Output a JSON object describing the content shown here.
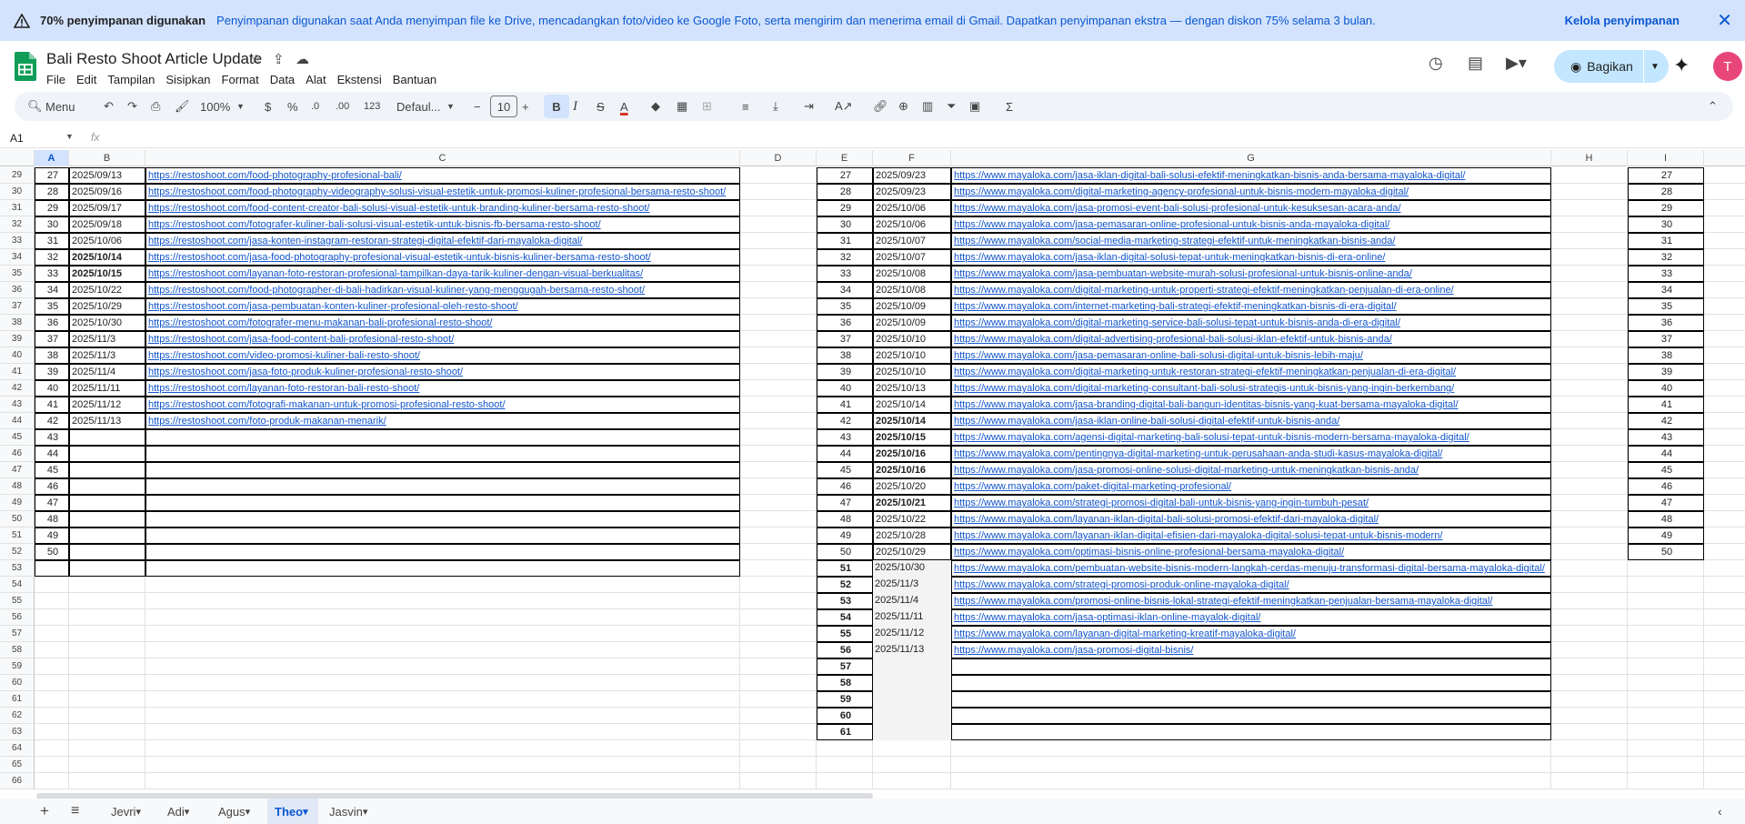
{
  "banner": {
    "title": "70% penyimpanan digunakan",
    "body": "Penyimpanan digunakan saat Anda menyimpan file ke Drive, mencadangkan foto/video ke Google Foto, serta mengirim dan menerima email di Gmail. Dapatkan penyimpanan ekstra — dengan diskon 75% selama 3 bulan.",
    "action": "Kelola penyimpanan"
  },
  "doc": {
    "title": "Bali Resto Shoot Article Update"
  },
  "menu": [
    "File",
    "Edit",
    "Tampilan",
    "Sisipkan",
    "Format",
    "Data",
    "Alat",
    "Ekstensi",
    "Bantuan"
  ],
  "share": {
    "label": "Bagikan"
  },
  "avatar": {
    "initial": "T"
  },
  "toolbar": {
    "search": "Menu",
    "zoom": "100%",
    "currency": "$",
    "percent": "%",
    "dec_minus": ".0",
    "dec_plus": ".00",
    "format_num": "123",
    "font": "Defaul...",
    "font_size": "10",
    "bold": "B",
    "italic": "I",
    "strike": "S",
    "text_color": "A"
  },
  "formula": {
    "namebox": "A1",
    "fx": "fx"
  },
  "columns": [
    "A",
    "B",
    "C",
    "D",
    "E",
    "F",
    "G",
    "H",
    "I"
  ],
  "rows": [
    29,
    30,
    31,
    32,
    33,
    34,
    35,
    36,
    37,
    38,
    39,
    40,
    41,
    42,
    43,
    44,
    45,
    46,
    47,
    48,
    49,
    50,
    51,
    52,
    53,
    54,
    55,
    56,
    57,
    58,
    59,
    60,
    61,
    62,
    63,
    64,
    65,
    66
  ],
  "left_table": [
    {
      "n": "27",
      "date": "2025/09/13",
      "url": "https://restoshoot.com/food-photography-profesional-bali/",
      "bold": false
    },
    {
      "n": "28",
      "date": "2025/09/16",
      "url": "https://restoshoot.com/food-photography-videography-solusi-visual-estetik-untuk-promosi-kuliner-profesional-bersama-resto-shoot/",
      "bold": false
    },
    {
      "n": "29",
      "date": "2025/09/17",
      "url": "https://restoshoot.com/food-content-creator-bali-solusi-visual-estetik-untuk-branding-kuliner-bersama-resto-shoot/",
      "bold": false
    },
    {
      "n": "30",
      "date": "2025/09/18",
      "url": "https://restoshoot.com/fotografer-kuliner-bali-solusi-visual-estetik-untuk-bisnis-fb-bersama-resto-shoot/",
      "bold": false
    },
    {
      "n": "31",
      "date": "2025/10/06",
      "url": "https://restoshoot.com/jasa-konten-instagram-restoran-strategi-digital-efektif-dari-mayaloka-digital/",
      "bold": false
    },
    {
      "n": "32",
      "date": "2025/10/14",
      "url": "https://restoshoot.com/jasa-food-photography-profesional-visual-estetik-untuk-bisnis-kuliner-bersama-resto-shoot/",
      "bold": true
    },
    {
      "n": "33",
      "date": "2025/10/15",
      "url": "https://restoshoot.com/layanan-foto-restoran-profesional-tampilkan-daya-tarik-kuliner-dengan-visual-berkualitas/",
      "bold": true
    },
    {
      "n": "34",
      "date": "2025/10/22",
      "url": "https://restoshoot.com/food-photographer-di-bali-hadirkan-visual-kuliner-yang-menggugah-bersama-resto-shoot/",
      "bold": false
    },
    {
      "n": "35",
      "date": "2025/10/29",
      "url": "https://restoshoot.com/jasa-pembuatan-konten-kuliner-profesional-oleh-resto-shoot/",
      "bold": false
    },
    {
      "n": "36",
      "date": "2025/10/30",
      "url": "https://restoshoot.com/fotografer-menu-makanan-bali-profesional-resto-shoot/",
      "bold": false
    },
    {
      "n": "37",
      "date": "2025/11/3",
      "url": "https://restoshoot.com/jasa-food-content-bali-profesional-resto-shoot/",
      "bold": false
    },
    {
      "n": "38",
      "date": "2025/11/3",
      "url": "https://restoshoot.com/video-promosi-kuliner-bali-resto-shoot/",
      "bold": false
    },
    {
      "n": "39",
      "date": "2025/11/4",
      "url": "https://restoshoot.com/jasa-foto-produk-kuliner-profesional-resto-shoot/",
      "bold": false
    },
    {
      "n": "40",
      "date": "2025/11/11",
      "url": "https://restoshoot.com/layanan-foto-restoran-bali-resto-shoot/",
      "bold": false
    },
    {
      "n": "41",
      "date": "2025/11/12",
      "url": "https://restoshoot.com/fotografi-makanan-untuk-promosi-profesional-resto-shoot/",
      "bold": false
    },
    {
      "n": "42",
      "date": "2025/11/13",
      "url": "https://restoshoot.com/foto-produk-makanan-menarik/",
      "bold": false
    },
    {
      "n": "43",
      "date": "",
      "url": "",
      "bold": false
    },
    {
      "n": "44",
      "date": "",
      "url": "",
      "bold": false
    },
    {
      "n": "45",
      "date": "",
      "url": "",
      "bold": false
    },
    {
      "n": "46",
      "date": "",
      "url": "",
      "bold": false
    },
    {
      "n": "47",
      "date": "",
      "url": "",
      "bold": false
    },
    {
      "n": "48",
      "date": "",
      "url": "",
      "bold": false
    },
    {
      "n": "49",
      "date": "",
      "url": "",
      "bold": false
    },
    {
      "n": "50",
      "date": "",
      "url": "",
      "bold": false
    },
    {
      "n": "",
      "date": "",
      "url": "",
      "bold": false
    }
  ],
  "right_table": [
    {
      "n": "27",
      "date": "2025/09/23",
      "url": "https://www.mayaloka.com/jasa-iklan-digital-bali-solusi-efektif-meningkatkan-bisnis-anda-bersama-mayaloka-digital/",
      "bold": false
    },
    {
      "n": "28",
      "date": "2025/09/23",
      "url": "https://www.mayaloka.com/digital-marketing-agency-profesional-untuk-bisnis-modern-mayaloka-digital/",
      "bold": false
    },
    {
      "n": "29",
      "date": "2025/10/06",
      "url": "https://www.mayaloka.com/jasa-promosi-event-bali-solusi-profesional-untuk-kesuksesan-acara-anda/",
      "bold": false
    },
    {
      "n": "30",
      "date": "2025/10/06",
      "url": "https://www.mayaloka.com/jasa-pemasaran-online-profesional-untuk-bisnis-anda-mayaloka-digital/",
      "bold": false
    },
    {
      "n": "31",
      "date": "2025/10/07",
      "url": "https://www.mayaloka.com/social-media-marketing-strategi-efektif-untuk-meningkatkan-bisnis-anda/",
      "bold": false
    },
    {
      "n": "32",
      "date": "2025/10/07",
      "url": "https://www.mayaloka.com/jasa-iklan-digital-solusi-tepat-untuk-meningkatkan-bisnis-di-era-online/",
      "bold": false
    },
    {
      "n": "33",
      "date": "2025/10/08",
      "url": "https://www.mayaloka.com/jasa-pembuatan-website-murah-solusi-profesional-untuk-bisnis-online-anda/",
      "bold": false
    },
    {
      "n": "34",
      "date": "2025/10/08",
      "url": "https://www.mayaloka.com/digital-marketing-untuk-properti-strategi-efektif-meningkatkan-penjualan-di-era-online/",
      "bold": false
    },
    {
      "n": "35",
      "date": "2025/10/09",
      "url": "https://www.mayaloka.com/internet-marketing-bali-strategi-efektif-meningkatkan-bisnis-di-era-digital/",
      "bold": false
    },
    {
      "n": "36",
      "date": "2025/10/09",
      "url": "https://www.mayaloka.com/digital-marketing-service-bali-solusi-tepat-untuk-bisnis-anda-di-era-digital/",
      "bold": false
    },
    {
      "n": "37",
      "date": "2025/10/10",
      "url": "https://www.mayaloka.com/digital-advertising-profesional-bali-solusi-iklan-efektif-untuk-bisnis-anda/",
      "bold": false
    },
    {
      "n": "38",
      "date": "2025/10/10",
      "url": "https://www.mayaloka.com/jasa-pemasaran-online-bali-solusi-digital-untuk-bisnis-lebih-maju/",
      "bold": false
    },
    {
      "n": "39",
      "date": "2025/10/10",
      "url": "https://www.mayaloka.com/digital-marketing-untuk-restoran-strategi-efektif-meningkatkan-penjualan-di-era-digital/",
      "bold": false
    },
    {
      "n": "40",
      "date": "2025/10/13",
      "url": "https://www.mayaloka.com/digital-marketing-consultant-bali-solusi-strategis-untuk-bisnis-yang-ingin-berkembang/",
      "bold": false
    },
    {
      "n": "41",
      "date": "2025/10/14",
      "url": "https://www.mayaloka.com/jasa-branding-digital-bali-bangun-identitas-bisnis-yang-kuat-bersama-mayaloka-digital/",
      "bold": false
    },
    {
      "n": "42",
      "date": "2025/10/14",
      "url": "https://www.mayaloka.com/jasa-iklan-online-bali-solusi-digital-efektif-untuk-bisnis-anda/",
      "bold": true
    },
    {
      "n": "43",
      "date": "2025/10/15",
      "url": "https://www.mayaloka.com/agensi-digital-marketing-bali-solusi-tepat-untuk-bisnis-modern-bersama-mayaloka-digital/",
      "bold": true
    },
    {
      "n": "44",
      "date": "2025/10/16",
      "url": "https://www.mayaloka.com/pentingnya-digital-marketing-untuk-perusahaan-anda-studi-kasus-mayaloka-digital/",
      "bold": true
    },
    {
      "n": "45",
      "date": "2025/10/16",
      "url": "https://www.mayaloka.com/jasa-promosi-online-solusi-digital-marketing-untuk-meningkatkan-bisnis-anda/",
      "bold": true
    },
    {
      "n": "46",
      "date": "2025/10/20",
      "url": "https://www.mayaloka.com/paket-digital-marketing-profesional/",
      "bold": false
    },
    {
      "n": "47",
      "date": "2025/10/21",
      "url": "https://www.mayaloka.com/strategi-promosi-digital-bali-untuk-bisnis-yang-ingin-tumbuh-pesat/",
      "bold": true
    },
    {
      "n": "48",
      "date": "2025/10/22",
      "url": "https://www.mayaloka.com/layanan-iklan-digital-bali-solusi-promosi-efektif-dari-mayaloka-digital/",
      "bold": false
    },
    {
      "n": "49",
      "date": "2025/10/28",
      "url": "https://www.mayaloka.com/layanan-iklan-digital-efisien-dari-mayaloka-digital-solusi-tepat-untuk-bisnis-modern/",
      "bold": false
    },
    {
      "n": "50",
      "date": "2025/10/29",
      "url": "https://www.mayaloka.com/optimasi-bisnis-online-profesional-bersama-mayaloka-digital/",
      "bold": false
    },
    {
      "n": "51",
      "date": "2025/10/30",
      "url": "https://www.mayaloka.com/pembuatan-website-bisnis-modern-langkah-cerdas-menuju-transformasi-digital-bersama-mayaloka-digital/",
      "bold": false
    },
    {
      "n": "52",
      "date": "2025/11/3",
      "url": "https://www.mayaloka.com/strategi-promosi-produk-online-mayaloka-digital/",
      "bold": false
    },
    {
      "n": "53",
      "date": "2025/11/4",
      "url": "https://www.mayaloka.com/promosi-online-bisnis-lokal-strategi-efektif-meningkatkan-penjualan-bersama-mayaloka-digital/",
      "bold": false
    },
    {
      "n": "54",
      "date": "2025/11/11",
      "url": "https://www.mayaloka.com/jasa-optimasi-iklan-online-mayalok-digital/",
      "bold": false
    },
    {
      "n": "55",
      "date": "2025/11/12",
      "url": "https://www.mayaloka.com/layanan-digital-marketing-kreatif-mayaloka-digital/",
      "bold": false
    },
    {
      "n": "56",
      "date": "2025/11/13",
      "url": "https://www.mayaloka.com/jasa-promosi-digital-bisnis/",
      "bold": false
    },
    {
      "n": "57",
      "date": "",
      "url": "",
      "bold": false
    },
    {
      "n": "58",
      "date": "",
      "url": "",
      "bold": false
    },
    {
      "n": "59",
      "date": "",
      "url": "",
      "bold": false
    },
    {
      "n": "60",
      "date": "",
      "url": "",
      "bold": false
    },
    {
      "n": "61",
      "date": "",
      "url": "",
      "bold": false
    }
  ],
  "col_i": [
    "27",
    "28",
    "29",
    "30",
    "31",
    "32",
    "33",
    "34",
    "35",
    "36",
    "37",
    "38",
    "39",
    "40",
    "41",
    "42",
    "43",
    "44",
    "45",
    "46",
    "47",
    "48",
    "49",
    "50"
  ],
  "sheets": [
    {
      "name": "Jevri",
      "active": false
    },
    {
      "name": "Adi",
      "active": false
    },
    {
      "name": "Agus",
      "active": false
    },
    {
      "name": "Theo",
      "active": true
    },
    {
      "name": "Jasvin",
      "active": false
    }
  ]
}
